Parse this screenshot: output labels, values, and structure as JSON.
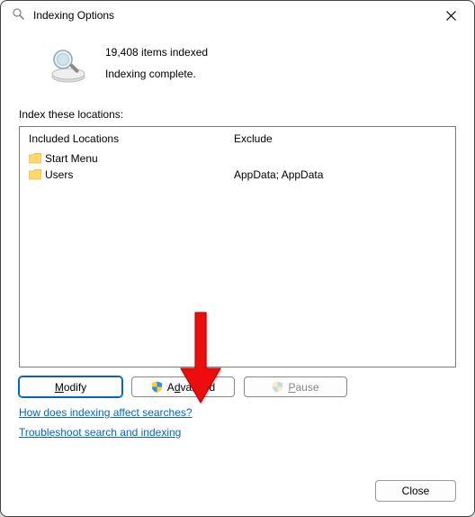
{
  "titlebar": {
    "title": "Indexing Options"
  },
  "status": {
    "count_text": "19,408 items indexed",
    "state_text": "Indexing complete."
  },
  "section_label": "Index these locations:",
  "columns": {
    "included": "Included Locations",
    "exclude": "Exclude"
  },
  "rows": [
    {
      "included": "Start Menu",
      "exclude": ""
    },
    {
      "included": "Users",
      "exclude": "AppData; AppData"
    }
  ],
  "buttons": {
    "modify": "Modify",
    "advanced": "Advanced",
    "pause": "Pause",
    "close": "Close"
  },
  "links": {
    "how": "How does indexing affect searches?",
    "troubleshoot": "Troubleshoot search and indexing"
  }
}
